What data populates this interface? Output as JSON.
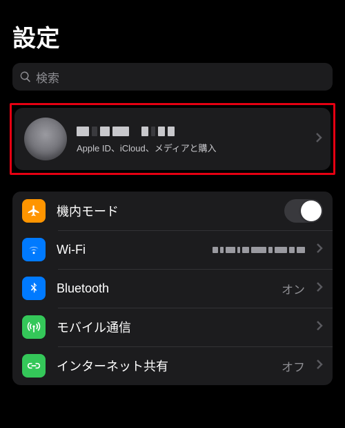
{
  "header": {
    "title": "設定"
  },
  "search": {
    "placeholder": "検索"
  },
  "profile": {
    "name_redacted": true,
    "subtitle": "Apple ID、iCloud、メディアと購入"
  },
  "rows": {
    "airplane": {
      "label": "機内モード",
      "toggle_on": false
    },
    "wifi": {
      "label": "Wi-Fi",
      "value_redacted": true
    },
    "bluetooth": {
      "label": "Bluetooth",
      "value": "オン"
    },
    "cellular": {
      "label": "モバイル通信"
    },
    "hotspot": {
      "label": "インターネット共有",
      "value": "オフ"
    }
  }
}
